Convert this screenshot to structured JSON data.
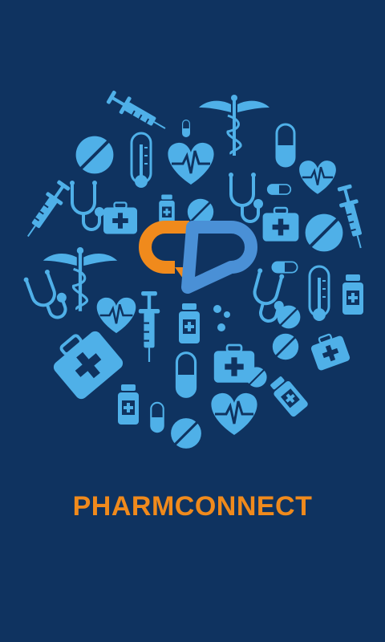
{
  "app": {
    "name": "PHARMCONNECT"
  },
  "splash": {
    "logo": "pill-link-logo",
    "icons": [
      "syringe-icon",
      "caduceus-icon",
      "capsule-icon",
      "pill-icon",
      "thermometer-icon",
      "heart-pulse-icon",
      "stethoscope-icon",
      "first-aid-kit-icon",
      "medicine-bottle-icon"
    ]
  },
  "colors": {
    "background": "#0f3360",
    "icon_blue": "#4fb0e8",
    "accent_orange": "#f08a1c",
    "logo_blue": "#4a90d6"
  }
}
